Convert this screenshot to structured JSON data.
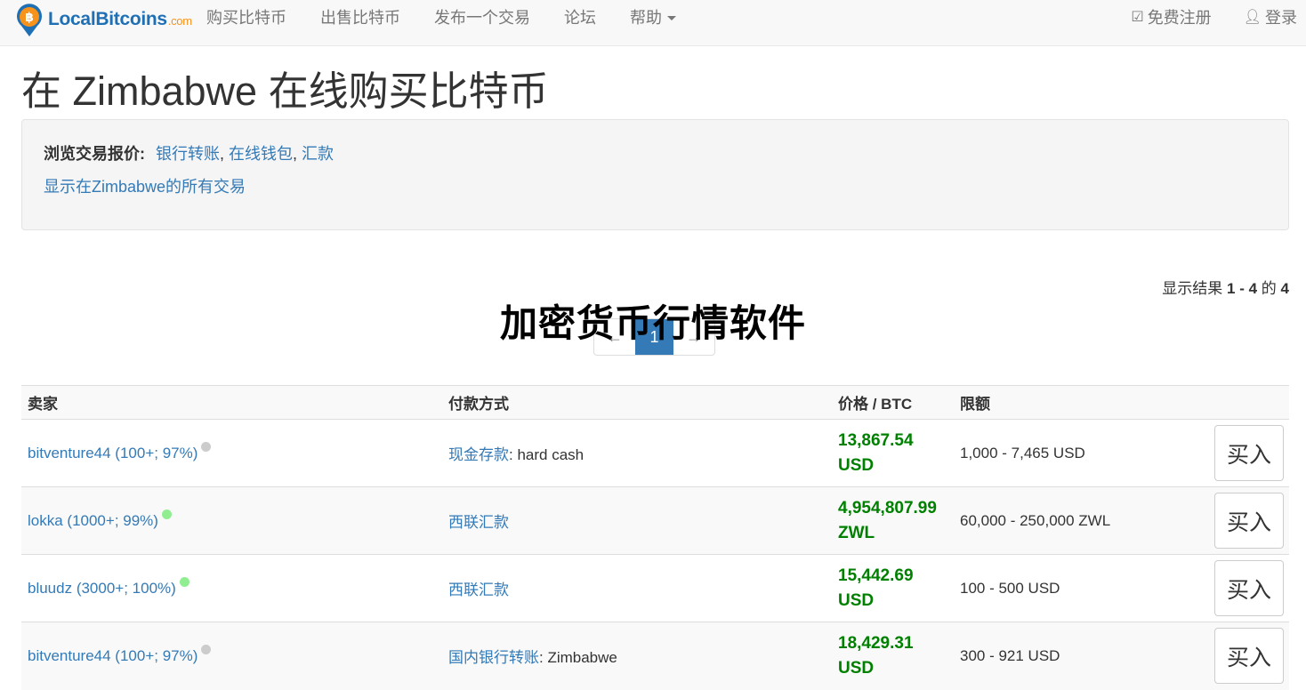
{
  "brand": {
    "name": "LocalBitcoins",
    "suffix": ".com"
  },
  "nav": {
    "items": [
      {
        "label": "购买比特币"
      },
      {
        "label": "出售比特币"
      },
      {
        "label": "发布一个交易"
      },
      {
        "label": "论坛"
      },
      {
        "label": "帮助"
      }
    ],
    "register": "免费注册",
    "login": "登录"
  },
  "page_title": "在 Zimbabwe 在线购买比特币",
  "browse": {
    "label": "浏览交易报价:",
    "links": [
      "银行转账",
      "在线钱包",
      "汇款"
    ],
    "show_all": "显示在Zimbabwe的所有交易"
  },
  "results": {
    "prefix": "显示结果",
    "range": "1 - 4",
    "of": "的",
    "total": "4"
  },
  "pager": {
    "prev": "←",
    "current": "1",
    "next": "→"
  },
  "overlay_text": "加密货币行情软件",
  "table": {
    "headers": {
      "seller": "卖家",
      "payment": "付款方式",
      "price": "价格 / BTC",
      "limit": "限额"
    },
    "rows": [
      {
        "seller": "bitventure44 (100+; 97%)",
        "status": "grey",
        "method": "现金存款",
        "detail": ": hard cash",
        "price_amount": "13,867.54",
        "price_currency": "USD",
        "limit": "1,000 - 7,465 USD",
        "button": "买入"
      },
      {
        "seller": "lokka (1000+; 99%)",
        "status": "green",
        "method": "西联汇款",
        "detail": "",
        "price_amount": "4,954,807.99",
        "price_currency": "ZWL",
        "limit": "60,000 - 250,000 ZWL",
        "button": "买入"
      },
      {
        "seller": "bluudz (3000+; 100%)",
        "status": "green",
        "method": "西联汇款",
        "detail": "",
        "price_amount": "15,442.69",
        "price_currency": "USD",
        "limit": "100 - 500 USD",
        "button": "买入"
      },
      {
        "seller": "bitventure44 (100+; 97%)",
        "status": "grey",
        "method": "国内银行转账",
        "detail": ": Zimbabwe",
        "price_amount": "18,429.31",
        "price_currency": "USD",
        "limit": "300 - 921 USD",
        "button": "买入"
      }
    ]
  },
  "colors": {
    "link": "#337ab7",
    "price": "#008000",
    "online_dot": "#90ee90",
    "offline_dot": "#cccccc",
    "pager_active": "#337ab7"
  }
}
